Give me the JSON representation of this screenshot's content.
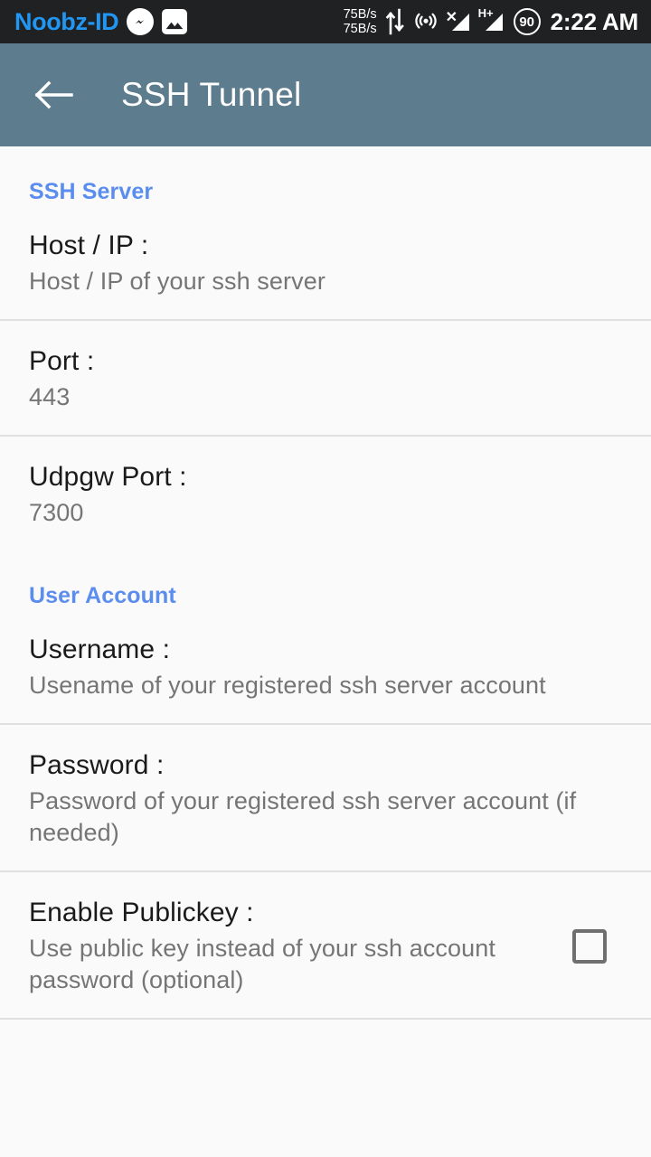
{
  "status_bar": {
    "carrier": "Noobz-ID",
    "icons": [
      "messenger-icon",
      "gallery-icon"
    ],
    "network_speed_down": "75B/s",
    "network_speed_up": "75B/s",
    "data_arrows_icon": "up-down-arrows-icon",
    "hotspot_icon": "hotspot-icon",
    "sim1_signal_icon": "no-sim-signal-icon",
    "sim1_label": "✕",
    "sim2_signal_icon": "signal-bars-icon",
    "sim2_network_type": "H+",
    "battery_percent": "90",
    "time": "2:22 AM",
    "background_color": "#1f2123",
    "carrier_color": "#2196f3"
  },
  "app_bar": {
    "back_icon": "back-arrow-icon",
    "title": "SSH Tunnel",
    "background_color": "#5d7d8e",
    "title_color": "#ffffff"
  },
  "accent_color": "#5b8def",
  "sections": [
    {
      "header": "SSH Server",
      "items": [
        {
          "name": "host-ip",
          "title": "Host / IP :",
          "summary": "Host / IP of your ssh server",
          "widget": "none"
        },
        {
          "name": "port",
          "title": "Port :",
          "summary": "443",
          "widget": "none"
        },
        {
          "name": "udpgw-port",
          "title": "Udpgw Port :",
          "summary": "7300",
          "widget": "none"
        }
      ]
    },
    {
      "header": "User Account",
      "items": [
        {
          "name": "username",
          "title": "Username :",
          "summary": "Usename of your registered ssh server account",
          "widget": "none"
        },
        {
          "name": "password",
          "title": "Password :",
          "summary": "Password of your registered ssh server account (if needed)",
          "widget": "none"
        },
        {
          "name": "enable-publickey",
          "title": "Enable Publickey :",
          "summary": "Use public key instead of your ssh account password (optional)",
          "widget": "checkbox",
          "checked": false
        }
      ]
    }
  ]
}
